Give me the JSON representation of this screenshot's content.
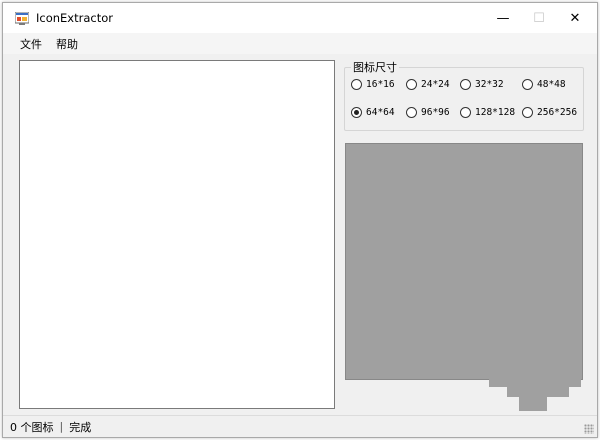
{
  "window": {
    "title": "IconExtractor",
    "icon": "app-icon",
    "controls": {
      "minimize": "—",
      "maximize": "☐",
      "close": "✕"
    }
  },
  "menu": {
    "items": [
      {
        "label": "文件"
      },
      {
        "label": "帮助"
      }
    ]
  },
  "icon_size_group": {
    "title": "图标尺寸",
    "options": [
      {
        "label": "16*16",
        "checked": false
      },
      {
        "label": "24*24",
        "checked": false
      },
      {
        "label": "32*32",
        "checked": false
      },
      {
        "label": "48*48",
        "checked": false
      },
      {
        "label": "64*64",
        "checked": true
      },
      {
        "label": "96*96",
        "checked": false
      },
      {
        "label": "128*128",
        "checked": false
      },
      {
        "label": "256*256",
        "checked": false
      }
    ]
  },
  "statusbar": {
    "count": "0 个图标",
    "separator": "|",
    "status": "完成"
  },
  "colors": {
    "preview_bg": "#a0a0a0",
    "window_bg": "#f0f0f0",
    "list_bg": "#ffffff"
  }
}
